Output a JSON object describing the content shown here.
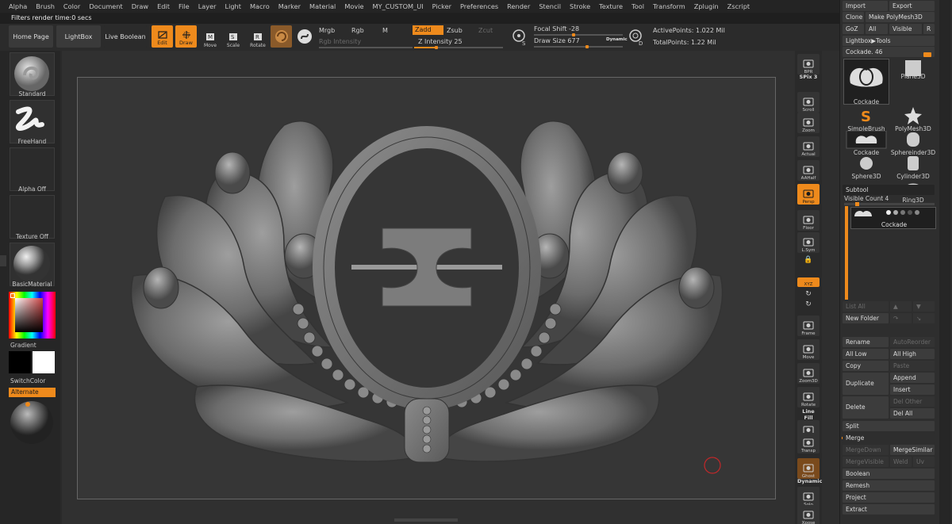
{
  "menu": [
    "Alpha",
    "Brush",
    "Color",
    "Document",
    "Draw",
    "Edit",
    "File",
    "Layer",
    "Light",
    "Macro",
    "Marker",
    "Material",
    "Movie",
    "MY_CUSTOM_UI",
    "Picker",
    "Preferences",
    "Render",
    "Stencil",
    "Stroke",
    "Texture",
    "Tool",
    "Transform",
    "Zplugin",
    "Zscript"
  ],
  "status": "Filters render time:0 secs",
  "shelf": {
    "home": "Home Page",
    "lightbox": "LightBox",
    "live_boolean": "Live Boolean",
    "edit": "Edit",
    "draw": "Draw",
    "move": "Move",
    "scale": "Scale",
    "rotate": "Rotate",
    "mrgb": "Mrgb",
    "rgb": "Rgb",
    "m": "M",
    "rgb_intensity": "Rgb Intensity",
    "zadd": "Zadd",
    "zsub": "Zsub",
    "zcut": "Zcut",
    "z_intensity": "Z Intensity 25",
    "focal": "Focal Shift -28",
    "drawsize": "Draw Size 677",
    "dynamic": "Dynamic",
    "active": "ActivePoints: 1.022 Mil",
    "total": "TotalPoints: 1.22 Mil",
    "z_intensity_pct": 25,
    "focal_pct": 45,
    "drawsize_pct": 60
  },
  "left": {
    "brush": "Standard",
    "stroke": "FreeHand",
    "alpha": "Alpha Off",
    "texture": "Texture Off",
    "material": "BasicMaterial",
    "gradient": "Gradient",
    "switch": "SwitchColor",
    "alternate": "Alternate"
  },
  "right_tools": [
    "BPR",
    "SPix 3",
    "Scroll",
    "Zoom",
    "Actual",
    "AAHalf",
    "Persp",
    "Floor",
    "L.Sym",
    "",
    "XYZ",
    "",
    "",
    "Frame",
    "Move",
    "Zoom3D",
    "Rotate",
    "Line Fill",
    "PolyF",
    "Transp",
    "Ghost",
    "Dynamic",
    "Solo",
    "Xpose"
  ],
  "panel": {
    "import": "Import",
    "export": "Export",
    "clone": "Clone",
    "make_polymesh": "Make PolyMesh3D",
    "goz": "GoZ",
    "all": "All",
    "visible": "Visible",
    "r": "R",
    "lightbox_tools": "Lightbox▶Tools",
    "cockade_slider": "Cockade. 46",
    "grid": [
      [
        "Cockade",
        "Plane3D"
      ],
      [
        "SimpleBrush",
        "PolyMesh3D"
      ],
      [
        "Cockade",
        "Sphereinder3D"
      ],
      [
        "Sphere3D",
        "Cylinder3D"
      ],
      [
        "",
        "Ring3D"
      ]
    ],
    "subtool": "Subtool",
    "visible_count": "Visible Count 4",
    "subtool_item": "Cockade",
    "list_all": "List All",
    "new_folder": "New Folder",
    "rename": "Rename",
    "autoreorder": "AutoReorder",
    "all_low": "All Low",
    "all_high": "All High",
    "copy": "Copy",
    "paste": "Paste",
    "duplicate": "Duplicate",
    "append": "Append",
    "insert": "Insert",
    "delete": "Delete",
    "del_other": "Del Other",
    "del_all": "Del All",
    "split": "Split",
    "merge": "Merge",
    "mergedown": "MergeDown",
    "mergesimilar": "MergeSimilar",
    "mergevisible": "MergeVisible",
    "weld": "Weld",
    "uv": "Uv",
    "boolean": "Boolean",
    "remesh": "Remesh",
    "project": "Project",
    "extract": "Extract"
  },
  "colors": {
    "accent": "#ee8a1c",
    "bg": "#2a2a2a"
  }
}
